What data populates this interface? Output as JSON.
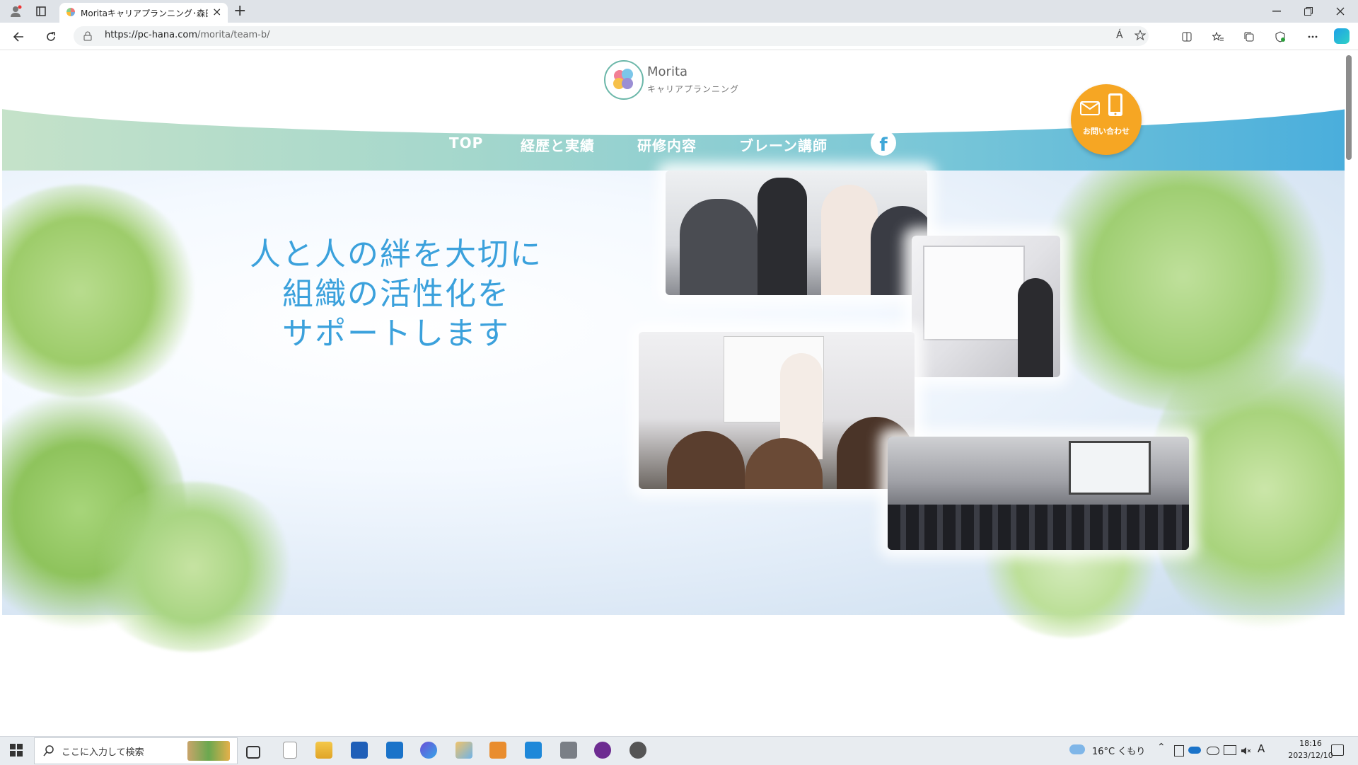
{
  "browser": {
    "tab_title": "Moritaキャリアプランニング･森田ひと",
    "url_host": "https://pc-hana.com",
    "url_path": "/morita/team-b/",
    "new_tab_symbol": "+",
    "close_symbol": "×",
    "read_aloud_label": "Á"
  },
  "site": {
    "logo_name": "Morita",
    "logo_sub": "キャリアプランニング",
    "nav": [
      "TOP",
      "経歴と実績",
      "研修内容",
      "ブレーン講師"
    ],
    "facebook_glyph": "f",
    "contact_label": "お問い合わせ",
    "headline": [
      "人と人の絆を大切に",
      "組織の活性化を",
      "サポートします"
    ]
  },
  "taskbar": {
    "search_placeholder": "ここに入力して検索",
    "weather": "16°C くもり",
    "time": "18:16",
    "date": "2023/12/10",
    "ime": "A"
  }
}
